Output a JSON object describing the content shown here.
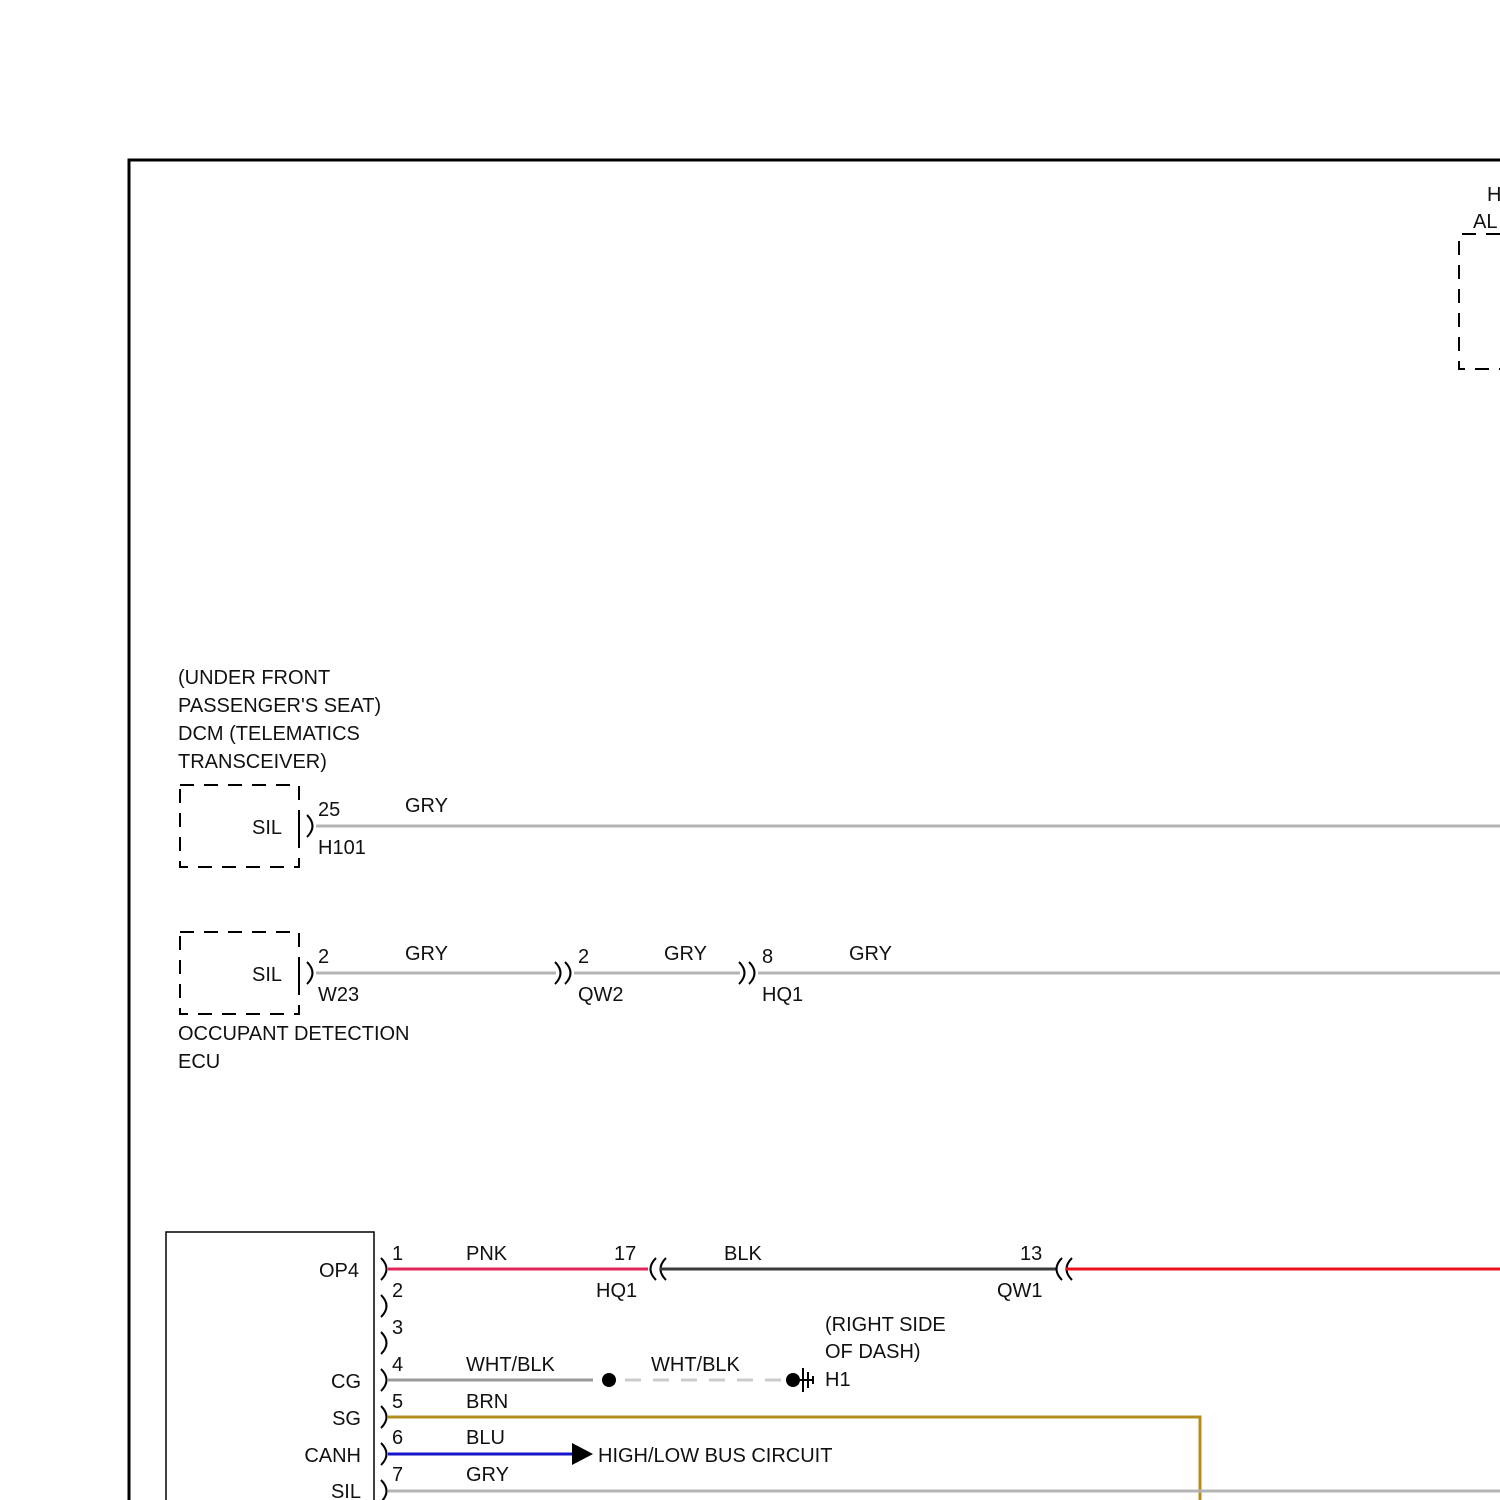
{
  "colors": {
    "frame": "#000000",
    "gray_wire": "#b4b4b4",
    "pink_wire": "#e2245a",
    "black_wire": "#3a3a3a",
    "red_wire": "#e8121d",
    "white_black_wire": "#9a9a9a",
    "white_black_dashed_wire": "#cccccc",
    "brown_wire": "#b48c1e",
    "blue_wire": "#1414c8",
    "component_outline": "#000000"
  },
  "top_right_component": {
    "label_line1": "H",
    "label_line2": "AL"
  },
  "dcm": {
    "location_line1": "(UNDER FRONT",
    "location_line2": "PASSENGER'S SEAT)",
    "name_line1": "DCM (TELEMATICS",
    "name_line2": "TRANSCEIVER)",
    "terminal_name": "SIL",
    "pin": "25",
    "connector": "H101",
    "wire_color": "GRY"
  },
  "occupant_ecu": {
    "terminal_name": "SIL",
    "pin": "2",
    "connector": "W23",
    "name_line1": "OCCUPANT DETECTION",
    "name_line2": "ECU",
    "segments": [
      {
        "wire_color": "GRY"
      },
      {
        "wire_color": "GRY",
        "pin": "2",
        "connector": "QW2"
      },
      {
        "wire_color": "GRY",
        "pin": "8",
        "connector": "HQ1"
      }
    ]
  },
  "dlc": {
    "connector": "OP4",
    "pins": [
      {
        "pin": "1",
        "terminal": "",
        "wire_color": "PNK"
      },
      {
        "pin": "2",
        "terminal": "",
        "wire_color": ""
      },
      {
        "pin": "3",
        "terminal": "",
        "wire_color": ""
      },
      {
        "pin": "4",
        "terminal": "CG",
        "wire_color": "WHT/BLK"
      },
      {
        "pin": "5",
        "terminal": "SG",
        "wire_color": "BRN"
      },
      {
        "pin": "6",
        "terminal": "CANH",
        "wire_color": "BLU"
      },
      {
        "pin": "7",
        "terminal": "SIL",
        "wire_color": "GRY"
      }
    ],
    "pin1_junctions": [
      {
        "pin": "17",
        "connector": "HQ1",
        "wire_color": "BLK"
      },
      {
        "pin": "13",
        "connector": "QW1"
      }
    ],
    "ground": {
      "wire_color": "WHT/BLK",
      "location_line1": "(RIGHT SIDE",
      "location_line2": "OF DASH)",
      "ground_point": "H1"
    },
    "bus_reference": "HIGH/LOW BUS CIRCUIT"
  }
}
